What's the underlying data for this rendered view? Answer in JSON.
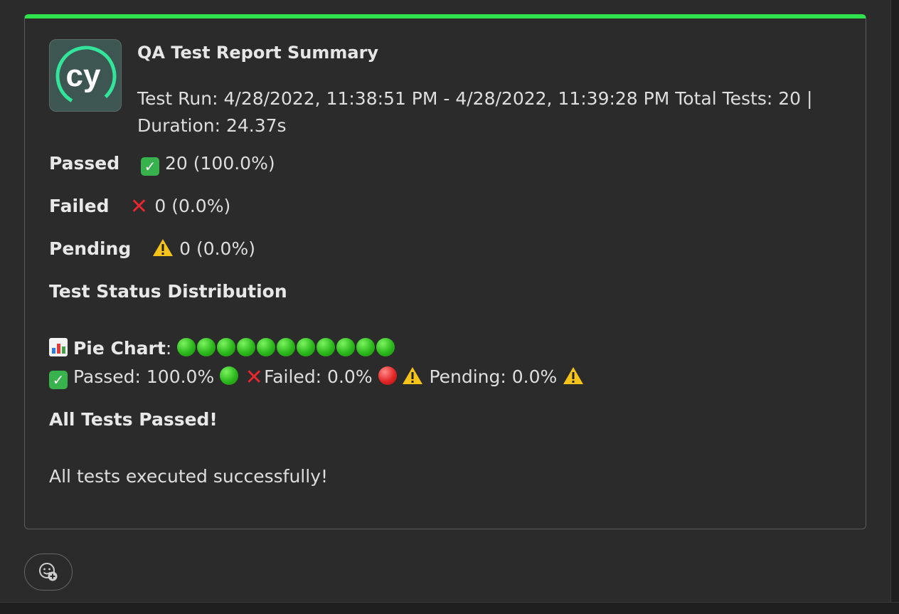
{
  "colors": {
    "accent_bar": "#2ee34b",
    "background": "#2b2b2b",
    "text": "#dedede",
    "logo_bg": "#3d5652",
    "logo_ring": "#33e49b"
  },
  "report": {
    "logo_text": "cy",
    "title": "QA Test Report Summary",
    "run_info": "Test Run: 4/28/2022, 11:38:51 PM - 4/28/2022, 11:39:28 PM Total Tests: 20 | Duration: 24.37s",
    "passed": {
      "label": "Passed",
      "value": "20 (100.0%)",
      "icon": "check-mark-button-icon"
    },
    "failed": {
      "label": "Failed",
      "value": "0 (0.0%)",
      "icon": "cross-mark-icon"
    },
    "pending": {
      "label": "Pending",
      "value": "0 (0.0%)",
      "icon": "warning-icon"
    },
    "distribution_heading": "Test Status Distribution",
    "pie_chart": {
      "label": "Pie Chart",
      "separator": ":",
      "green_dot_count": 11
    },
    "legend": {
      "passed": "Passed: 100.0%",
      "failed": "Failed: 0.0%",
      "pending": "Pending: 0.0%"
    },
    "result_heading": "All Tests Passed!",
    "result_message": "All tests executed successfully!"
  },
  "reaction_button": {
    "icon": "add-reaction-icon"
  }
}
